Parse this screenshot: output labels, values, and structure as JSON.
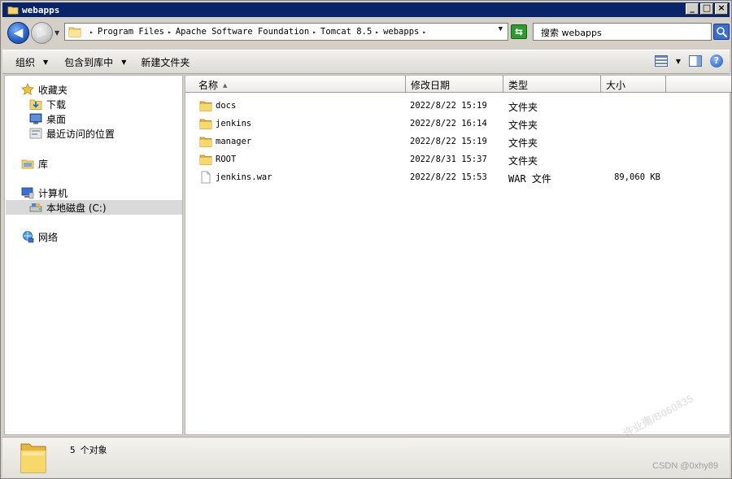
{
  "window": {
    "title": "webapps"
  },
  "address": {
    "crumbs": [
      "Program Files",
      "Apache Software Foundation",
      "Tomcat 8.5",
      "webapps"
    ]
  },
  "search": {
    "placeholder": "搜索 webapps"
  },
  "toolbar": {
    "organize": "组织",
    "include_in_library": "包含到库中",
    "new_folder": "新建文件夹"
  },
  "nav": {
    "favorites": "收藏夹",
    "downloads": "下载",
    "desktop": "桌面",
    "recent": "最近访问的位置",
    "libraries": "库",
    "computer": "计算机",
    "local_disk": "本地磁盘 (C:)",
    "network": "网络"
  },
  "columns": {
    "name": "名称",
    "modified": "修改日期",
    "type": "类型",
    "size": "大小"
  },
  "files": [
    {
      "name": "docs",
      "modified": "2022/8/22 15:19",
      "type": "文件夹",
      "size": "",
      "icon": "folder-icon"
    },
    {
      "name": "jenkins",
      "modified": "2022/8/22 16:14",
      "type": "文件夹",
      "size": "",
      "icon": "folder-icon"
    },
    {
      "name": "manager",
      "modified": "2022/8/22 15:19",
      "type": "文件夹",
      "size": "",
      "icon": "folder-icon"
    },
    {
      "name": "ROOT",
      "modified": "2022/8/31 15:37",
      "type": "文件夹",
      "size": "",
      "icon": "folder-icon"
    },
    {
      "name": "jenkins.war",
      "modified": "2022/8/22 15:53",
      "type": "WAR 文件",
      "size": "89,060 KB",
      "icon": "file-icon"
    }
  ],
  "status": {
    "count": "5",
    "count_label": "个对象"
  },
  "watermark": {
    "csdn": "CSDN @0xhy89",
    "diagonal": "许业南/B060835"
  },
  "colors": {
    "titlebar": "#0a246a",
    "selected": "#d9d9d9"
  }
}
